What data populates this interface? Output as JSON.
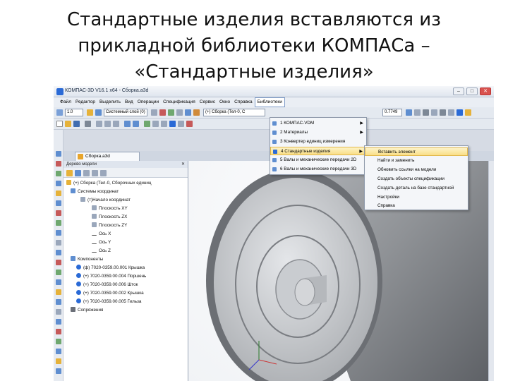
{
  "slide": {
    "title_lines": [
      "Стандартные изделия вставляются из",
      "прикладной библиотеки КОМПАСа –",
      "«Стандартные изделия»"
    ]
  },
  "window": {
    "title": "КОМПАС-3D V16.1 x64 - Сборка.a3d",
    "controls": [
      "–",
      "□",
      "✕"
    ]
  },
  "menubar": [
    "Файл",
    "Редактор",
    "Выделить",
    "Вид",
    "Операции",
    "Спецификация",
    "Сервис",
    "Окно",
    "Справка",
    "Библиотеки"
  ],
  "toolbar": {
    "scale_value": "1.0",
    "layer_combo": "Системный слой (0)",
    "assembly_combo": "(+) Сборка (Тел-0, С",
    "zoom_value": "0.7749"
  },
  "doc_tab": "Сборка.a3d",
  "tree": {
    "header": "Дерево модели",
    "root": "(+) Сборка (Тел-0, Сборочных единиц",
    "items": [
      "Системы координат",
      "(т)Начало координат",
      "Плоскость XY",
      "Плоскость ZX",
      "Плоскость ZY",
      "Ось X",
      "Ось Y",
      "Ось Z",
      "Компоненты",
      "(ф) 7020-0359.00.001 Крышка",
      "(+) 7020-0359.00.004 Поршень",
      "(+) 7020-0359.00.006 Шток",
      "(+) 7020-0359.00.002 Крышка",
      "(+) 7020-0359.00.005 Гильза",
      "Сопряжения"
    ]
  },
  "libraries_menu": [
    "1 КОМПАС-VDM",
    "2 Материалы",
    "3 Конвертер единиц измерения",
    "4 Стандартные изделия",
    "5 Валы и механические передачи 2D",
    "6 Валы и механические передачи 3D"
  ],
  "standard_parts_submenu": [
    "Вставить элемент",
    "Найти и заменить",
    "Обновить ссылки на модели",
    "Создать объекты спецификации",
    "Создать деталь на базе стандартной",
    "Настройки",
    "Справка"
  ],
  "colors": {
    "highlight": "#f9de86",
    "model_body": "#8f9296",
    "accent_blue": "#2a6ad6"
  }
}
